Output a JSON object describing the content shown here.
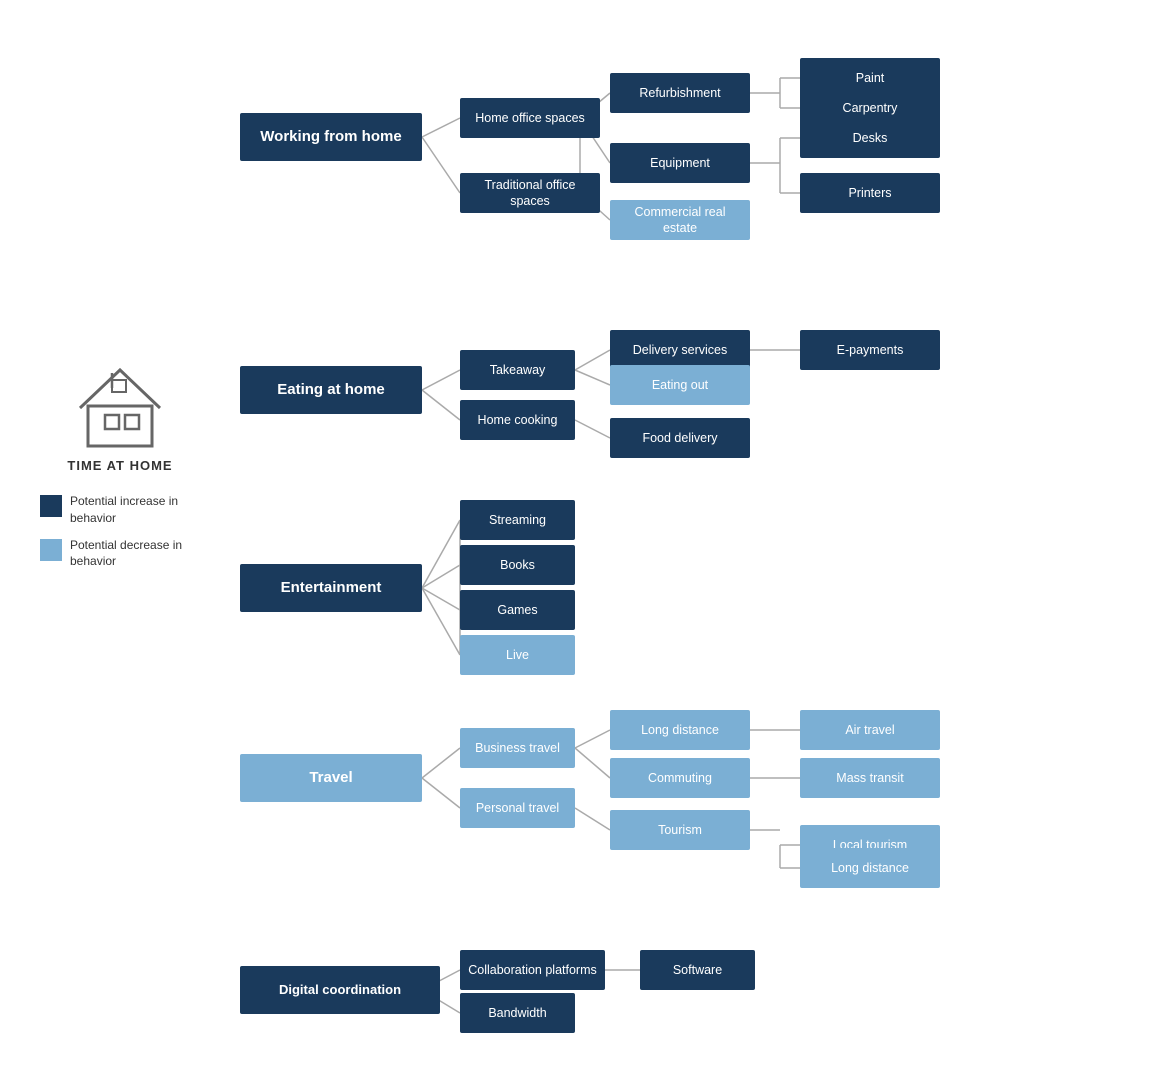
{
  "sidebar": {
    "title": "TIME AT HOME",
    "legend": [
      {
        "type": "dark",
        "text": "Potential increase in behavior"
      },
      {
        "type": "light",
        "text": "Potential decrease in behavior"
      }
    ]
  },
  "tree": {
    "sections": [
      {
        "id": "working",
        "label": "Working from home",
        "type": "dark",
        "children": [
          {
            "label": "Home office spaces",
            "type": "dark",
            "children": [
              {
                "label": "Refurbishment",
                "type": "dark",
                "children": [
                  {
                    "label": "Paint",
                    "type": "dark"
                  },
                  {
                    "label": "Carpentry",
                    "type": "dark"
                  }
                ]
              },
              {
                "label": "Equipment",
                "type": "dark",
                "children": [
                  {
                    "label": "Desks",
                    "type": "dark"
                  },
                  {
                    "label": "Printers",
                    "type": "dark"
                  }
                ]
              }
            ]
          },
          {
            "label": "Traditional office spaces",
            "type": "dark",
            "children": [
              {
                "label": "Commercial real estate",
                "type": "light"
              }
            ]
          }
        ]
      },
      {
        "id": "eating",
        "label": "Eating at home",
        "type": "dark",
        "children": [
          {
            "label": "Takeaway",
            "type": "dark",
            "children": [
              {
                "label": "Delivery services",
                "type": "dark",
                "children": [
                  {
                    "label": "E-payments",
                    "type": "dark"
                  }
                ]
              },
              {
                "label": "Eating out",
                "type": "light"
              }
            ]
          },
          {
            "label": "Home cooking",
            "type": "dark",
            "children": [
              {
                "label": "Food delivery",
                "type": "dark"
              }
            ]
          }
        ]
      },
      {
        "id": "entertainment",
        "label": "Entertainment",
        "type": "dark",
        "children": [
          {
            "label": "Streaming",
            "type": "dark"
          },
          {
            "label": "Books",
            "type": "dark"
          },
          {
            "label": "Games",
            "type": "dark"
          },
          {
            "label": "Live",
            "type": "light"
          }
        ]
      },
      {
        "id": "travel",
        "label": "Travel",
        "type": "light",
        "children": [
          {
            "label": "Business travel",
            "type": "light",
            "children": [
              {
                "label": "Long distance",
                "type": "light",
                "children": [
                  {
                    "label": "Air travel",
                    "type": "light"
                  }
                ]
              },
              {
                "label": "Commuting",
                "type": "light",
                "children": [
                  {
                    "label": "Mass transit",
                    "type": "light"
                  }
                ]
              }
            ]
          },
          {
            "label": "Personal travel",
            "type": "light",
            "children": [
              {
                "label": "Tourism",
                "type": "light",
                "children": [
                  {
                    "label": "Local tourism",
                    "type": "light"
                  },
                  {
                    "label": "Long distance",
                    "type": "light"
                  }
                ]
              }
            ]
          }
        ]
      },
      {
        "id": "digital",
        "label": "Digital coordination",
        "type": "dark",
        "children": [
          {
            "label": "Collaboration platforms",
            "type": "dark",
            "children": [
              {
                "label": "Software",
                "type": "dark"
              }
            ]
          },
          {
            "label": "Bandwidth",
            "type": "dark"
          }
        ]
      }
    ]
  }
}
